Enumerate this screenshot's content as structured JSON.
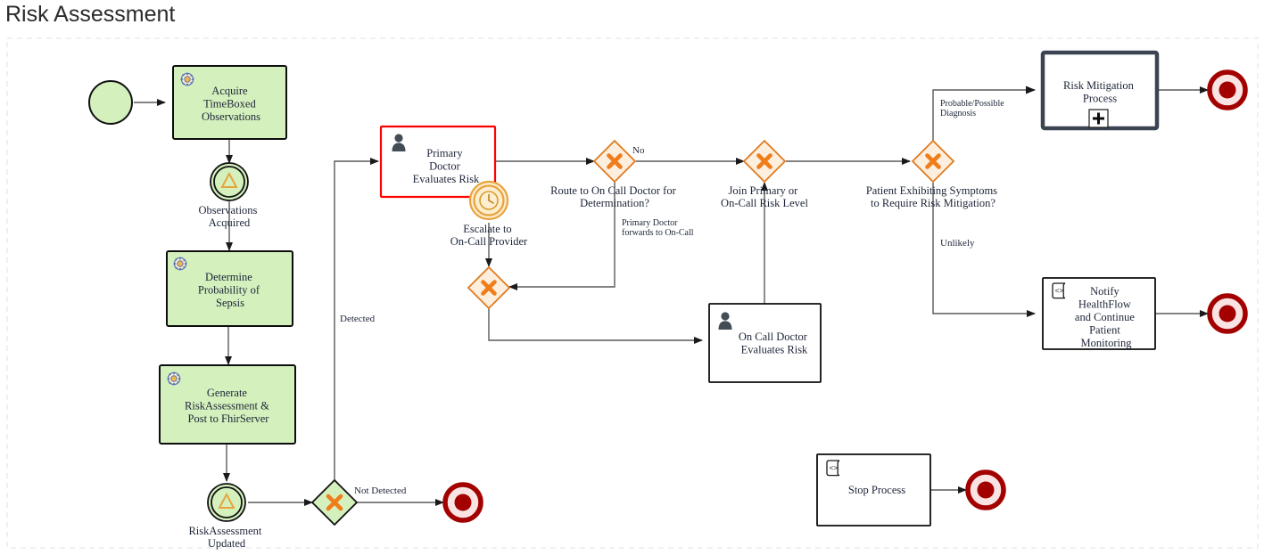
{
  "page": {
    "title": "Risk Assessment",
    "background": "#ffffff",
    "pool_border_color": "#eeeeee"
  },
  "palette": {
    "task_green_fill": "#d4f0bd",
    "task_white_fill": "#ffffff",
    "task_stroke": "#0d0d0d",
    "task_stroke_red": "#ff0000",
    "call_activity_stroke": "#3b4452",
    "gateway_fill": "#fdeedd",
    "gateway_stroke": "#e07b1e",
    "gateway_green_fill": "#d4f0bd",
    "gateway_mark": "#ef7d1a",
    "end_event_ring": "#a30000",
    "end_event_inner": "#fae3e3",
    "end_event_dot": "#a30000",
    "signal_event_stroke": "#111111",
    "signal_mark": "#e8a33d",
    "timer_ring": "#e8a33d",
    "timer_fill": "#fdeed0",
    "flow_stroke": "#5a5a5a",
    "text_color": "#1d2538"
  },
  "nodes": {
    "start_event": {
      "name": "start-event",
      "type": "start-event",
      "label": ""
    },
    "acquire_task": {
      "name": "task-acquire-timeboxed-observations",
      "type": "service-task",
      "label_lines": [
        "Acquire",
        "TimeBoxed",
        "Observations"
      ],
      "icon": "gear-icon"
    },
    "observations_acquired": {
      "name": "event-observations-acquired",
      "type": "intermediate-signal-event",
      "label_lines": [
        "Observations",
        "Acquired"
      ]
    },
    "determine_task": {
      "name": "task-determine-probability-of-sepsis",
      "type": "service-task",
      "label_lines": [
        "Determine",
        "Probability of",
        "Sepsis"
      ],
      "icon": "gear-icon"
    },
    "generate_task": {
      "name": "task-generate-riskassessment-post-to-fhirserver",
      "type": "service-task",
      "label_lines": [
        "Generate",
        "RiskAssessment &",
        "Post to FhirServer"
      ],
      "icon": "gear-icon"
    },
    "riskassessment_updated": {
      "name": "event-riskassessment-updated",
      "type": "intermediate-signal-event",
      "label_lines": [
        "RiskAssessment",
        "Updated"
      ]
    },
    "detection_gateway": {
      "name": "gateway-detection",
      "type": "exclusive-gateway-green",
      "label": ""
    },
    "end_not_detected": {
      "name": "end-event-not-detected",
      "type": "end-event",
      "label": ""
    },
    "primary_doctor_task": {
      "name": "task-primary-doctor-evaluates-risk",
      "type": "user-task",
      "label_lines": [
        "Primary",
        "Doctor",
        "Evaluates Risk"
      ],
      "icon": "user-icon"
    },
    "escalate_timer": {
      "name": "boundary-event-escalate-to-on-call-provider",
      "type": "timer-boundary-event",
      "label_lines": [
        "Escalate to",
        "On-Call Provider"
      ],
      "icon": "clock-icon"
    },
    "route_gateway": {
      "name": "gateway-route-to-on-call-doctor",
      "type": "exclusive-gateway",
      "label_lines": [
        "Route to On Call Doctor for",
        "Determination?"
      ]
    },
    "merge_gateway": {
      "name": "gateway-merge-to-on-call",
      "type": "exclusive-gateway",
      "label": ""
    },
    "on_call_doctor_task": {
      "name": "task-on-call-doctor-evaluates-risk",
      "type": "user-task",
      "label_lines": [
        "On Call Doctor",
        "Evaluates Risk"
      ],
      "icon": "user-icon"
    },
    "join_gateway": {
      "name": "gateway-join-primary-or-on-call-risk-level",
      "type": "exclusive-gateway",
      "label_lines": [
        "Join Primary or",
        "On-Call Risk Level"
      ]
    },
    "symptoms_gateway": {
      "name": "gateway-patient-exhibiting-symptoms",
      "type": "exclusive-gateway",
      "label_lines": [
        "Patient Exhibiting Symptoms",
        "to Require Risk Mitigation?"
      ]
    },
    "risk_mitigation_process": {
      "name": "call-activity-risk-mitigation-process",
      "type": "call-activity",
      "label_lines": [
        "Risk Mitigation",
        "Process"
      ],
      "marker": "plus-icon"
    },
    "end_mitigation": {
      "name": "end-event-risk-mitigation",
      "type": "end-event",
      "label": ""
    },
    "notify_task": {
      "name": "task-notify-healthflow-continue-monitoring",
      "type": "script-task",
      "label_lines": [
        "Notify",
        "HealthFlow",
        "and Continue",
        "Patient",
        "Monitoring"
      ],
      "icon": "script-icon"
    },
    "end_notify": {
      "name": "end-event-notify",
      "type": "end-event",
      "label": ""
    },
    "stop_process_task": {
      "name": "task-stop-process",
      "type": "script-task",
      "label_lines": [
        "Stop Process"
      ],
      "icon": "script-icon"
    },
    "end_stop": {
      "name": "end-event-stop-process",
      "type": "end-event",
      "label": ""
    }
  },
  "flow_labels": {
    "no": "No",
    "primary_forwards": [
      "Primary Doctor",
      "forwards to On-Call"
    ],
    "detected": "Detected",
    "not_detected": "Not Detected",
    "probable_possible": [
      "Probable/Possible",
      "Diagnosis"
    ],
    "unlikely": "Unlikely"
  }
}
